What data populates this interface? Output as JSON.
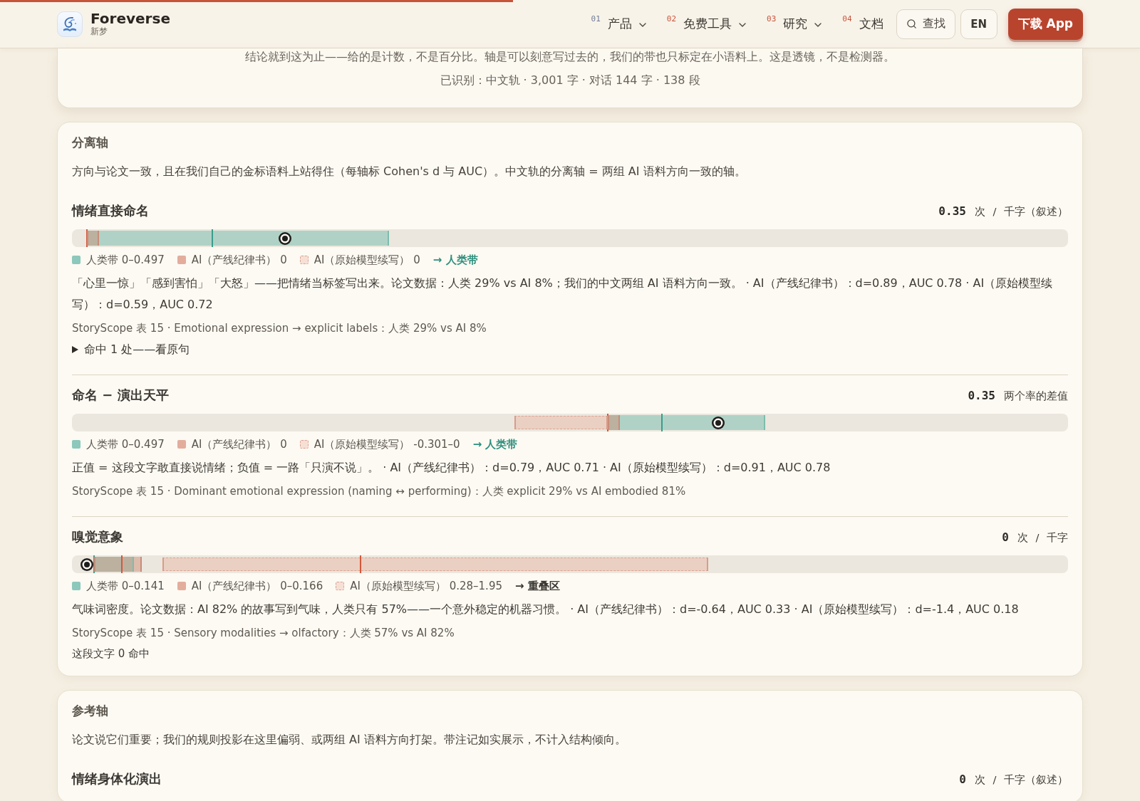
{
  "reading_progress": {
    "level": 0.45
  },
  "header": {
    "brand": {
      "name": "Foreverse",
      "subtitle": "新梦"
    },
    "nav": [
      {
        "number": "01",
        "label": "产品",
        "dropdown": true,
        "color": "#6f7c96"
      },
      {
        "number": "02",
        "label": "免费工具",
        "dropdown": true,
        "color": "#c8553d"
      },
      {
        "number": "03",
        "label": "研究",
        "dropdown": true,
        "color": "#c8553d"
      },
      {
        "number": "04",
        "label": "文档",
        "dropdown": false,
        "color": "#c8553d"
      }
    ],
    "search_button": "查找",
    "language_button": "EN",
    "download_button": "下载 App"
  },
  "summary_card": {
    "note": "结论就到这为止——给的是计数，不是百分比。轴是可以刻意写过去的，我们的带也只标定在小语料上。这是透镜，不是检测器。",
    "detected": "已识别：中文轨 · 3,001 字 · 对话 144 字 · 138 段"
  },
  "sections": [
    {
      "title": "分离轴",
      "description": "方向与论文一致，且在我们自己的金标语料上站得住（每轴标 Cohen's d 与 AUC）。中文轨的分离轴 = 两组 AI 语料方向一致的轴。",
      "metrics": [
        {
          "title": "情绪直接命名",
          "value": "0.35",
          "unit": "次 / 千字（叙述）",
          "track": {
            "bands": [
              {
                "kind": "human",
                "from": {
                  "level": 0.015
                },
                "to": {
                  "level": 0.318
                }
              },
              {
                "kind": "ai-line",
                "from": {
                  "level": 0.015
                },
                "to": {
                  "level": 0.027
                }
              }
            ],
            "ticks": [
              {
                "kind": "human",
                "level": 0.141
              },
              {
                "kind": "ai",
                "level": 0.015
              }
            ],
            "marker": {
              "level": 0.214
            }
          },
          "legend": [
            {
              "kind": "human",
              "label": "人类带 0–0.497"
            },
            {
              "kind": "ai-line",
              "label": "AI（产线纪律书） 0"
            },
            {
              "kind": "ai-raw",
              "label": "AI（原始模型续写） 0"
            }
          ],
          "verdict": {
            "kind": "human",
            "text": "→ 人类带"
          },
          "description": "「心里一惊」「感到害怕」「大怒」——把情绪当标签写出来。论文数据：人类 29% vs AI 8%；我们的中文两组 AI 语料方向一致。 · AI（产线纪律书）：d=0.89，AUC 0.78 · AI（原始模型续写）：d=0.59，AUC 0.72",
          "source": "StoryScope 表 15 · Emotional expression → explicit labels：人类 29% vs AI 8%",
          "footer": {
            "kind": "disclosure",
            "text": "命中 1 处——看原句",
            "expanded": false
          }
        },
        {
          "title": "命名 − 演出天平",
          "value": "0.35",
          "unit": "两个率的差值",
          "track": {
            "bands": [
              {
                "kind": "ai-raw",
                "from": {
                  "level": 0.444
                },
                "to": {
                  "level": 0.538
                }
              },
              {
                "kind": "human",
                "from": {
                  "level": 0.538
                },
                "to": {
                  "level": 0.696
                }
              },
              {
                "kind": "ai-line",
                "from": {
                  "level": 0.538
                },
                "to": {
                  "level": 0.55
                }
              }
            ],
            "ticks": [
              {
                "kind": "ai",
                "level": 0.538
              },
              {
                "kind": "human",
                "level": 0.592
              }
            ],
            "marker": {
              "level": 0.649
            }
          },
          "legend": [
            {
              "kind": "human",
              "label": "人类带 0–0.497"
            },
            {
              "kind": "ai-line",
              "label": "AI（产线纪律书） 0"
            },
            {
              "kind": "ai-raw",
              "label": "AI（原始模型续写） -0.301–0"
            }
          ],
          "verdict": {
            "kind": "human",
            "text": "→ 人类带"
          },
          "description": "正值 = 这段文字敢直接说情绪；负值 = 一路「只演不说」。 · AI（产线纪律书）：d=0.79，AUC 0.71 · AI（原始模型续写）：d=0.91，AUC 0.78",
          "source": "StoryScope 表 15 · Dominant emotional expression (naming ↔ performing)：人类 explicit 29% vs AI embodied 81%"
        },
        {
          "title": "嗅觉意象",
          "value": "0",
          "unit": "次 / 千字",
          "track": {
            "bands": [
              {
                "kind": "human",
                "from": {
                  "level": 0.022
                },
                "to": {
                  "level": 0.062
                }
              },
              {
                "kind": "ai-line",
                "from": {
                  "level": 0.022
                },
                "to": {
                  "level": 0.07
                }
              },
              {
                "kind": "ai-raw",
                "from": {
                  "level": 0.091
                },
                "to": {
                  "level": 0.639
                }
              }
            ],
            "ticks": [
              {
                "kind": "human",
                "level": 0.022
              },
              {
                "kind": "ai",
                "level": 0.05
              },
              {
                "kind": "ai",
                "level": 0.29
              }
            ],
            "marker": {
              "level": 0.015
            }
          },
          "legend": [
            {
              "kind": "human",
              "label": "人类带 0–0.141"
            },
            {
              "kind": "ai-line",
              "label": "AI（产线纪律书） 0–0.166"
            },
            {
              "kind": "ai-raw",
              "label": "AI（原始模型续写） 0.28–1.95"
            }
          ],
          "verdict": {
            "kind": "overlap",
            "text": "→ 重叠区"
          },
          "description": "气味词密度。论文数据：AI 82% 的故事写到气味，人类只有 57%——一个意外稳定的机器习惯。 · AI（产线纪律书）：d=-0.64，AUC 0.33 · AI（原始模型续写）：d=-1.4，AUC 0.18",
          "source": "StoryScope 表 15 · Sensory modalities → olfactory：人类 57% vs AI 82%",
          "footer": {
            "kind": "note",
            "text": "这段文字 0 命中"
          }
        }
      ]
    },
    {
      "title": "参考轴",
      "description": "论文说它们重要；我们的规则投影在这里偏弱、或两组 AI 语料方向打架。带注记如实展示，不计入结构倾向。",
      "metrics": [
        {
          "title": "情绪身体化演出",
          "value": "0",
          "unit": "次 / 千字（叙述）"
        }
      ]
    }
  ]
}
